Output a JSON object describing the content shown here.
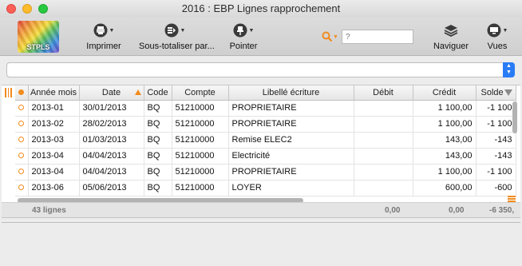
{
  "window": {
    "title": "2016 : EBP Lignes rapprochement"
  },
  "logo": {
    "text": "STPLS"
  },
  "toolbar": {
    "print_label": "Imprimer",
    "subtotal_label": "Sous-totaliser par...",
    "point_label": "Pointer",
    "navigate_label": "Naviguer",
    "views_label": "Vues"
  },
  "search": {
    "placeholder": "?",
    "value": ""
  },
  "table": {
    "headers": [
      "Année mois",
      "Date",
      "Code",
      "Compte",
      "Libellé écriture",
      "Débit",
      "Crédit",
      "Solde"
    ],
    "rows": [
      [
        "2013-01",
        "30/01/2013",
        "BQ",
        "51210000",
        "PROPRIETAIRE",
        "",
        "1 100,00",
        "-1 100"
      ],
      [
        "2013-02",
        "28/02/2013",
        "BQ",
        "51210000",
        "PROPRIETAIRE",
        "",
        "1 100,00",
        "-1 100"
      ],
      [
        "2013-03",
        "01/03/2013",
        "BQ",
        "51210000",
        "Remise ELEC2",
        "",
        "143,00",
        "-143"
      ],
      [
        "2013-04",
        "04/04/2013",
        "BQ",
        "51210000",
        "Electricité",
        "",
        "143,00",
        "-143"
      ],
      [
        "2013-04",
        "04/04/2013",
        "BQ",
        "51210000",
        "PROPRIETAIRE",
        "",
        "1 100,00",
        "-1 100"
      ],
      [
        "2013-06",
        "05/06/2013",
        "BQ",
        "51210000",
        "LOYER",
        "",
        "600,00",
        "-600"
      ]
    ]
  },
  "footer": {
    "count": "43 lignes",
    "debit_total": "0,00",
    "credit_total": "0,00",
    "balance_total": "-6 350,"
  },
  "colors": {
    "accent": "#f28b1e",
    "select_blue": "#2a7cf6"
  }
}
